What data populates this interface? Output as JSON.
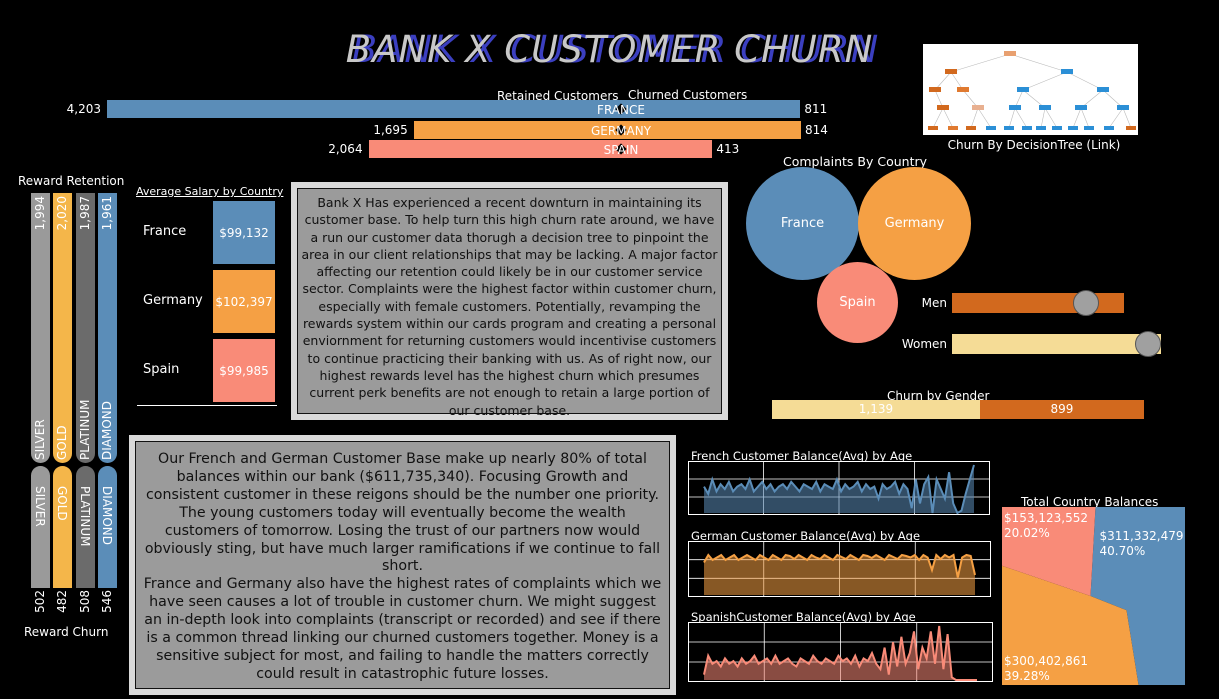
{
  "title": "BANK X CUSTOMER CHURN",
  "colors": {
    "france": "#5b8db8",
    "germany": "#f5a044",
    "spain": "#f98b78",
    "gray": "#9a9a9a",
    "gold": "#f4b64a",
    "dark_gray": "#6b6b6b",
    "men": "#d2691e",
    "women": "#f5dc96"
  },
  "country_churn": {
    "left_label": "Retained Customers",
    "right_label": "Churned Customers",
    "rows": [
      {
        "country": "FRANCE",
        "retained": 4203,
        "retained_label": "4,203",
        "churned": 811,
        "churned_label": "811"
      },
      {
        "country": "GERMANY",
        "retained": 1695,
        "retained_label": "1,695",
        "churned": 814,
        "churned_label": "814"
      },
      {
        "country": "SPAIN",
        "retained": 2064,
        "retained_label": "2,064",
        "churned": 413,
        "churned_label": "413"
      }
    ]
  },
  "tree": {
    "caption": "Churn By DecisionTree (Link)"
  },
  "rewards": {
    "top_title": "Reward Retention",
    "bottom_title": "Reward Churn",
    "tiers": [
      {
        "name": "SILVER",
        "retention": "1,994",
        "churn": "502"
      },
      {
        "name": "GOLD",
        "retention": "2,020",
        "churn": "482"
      },
      {
        "name": "PLATINUM",
        "retention": "1,987",
        "churn": "508"
      },
      {
        "name": "DIAMOND",
        "retention": "1,961",
        "churn": "546"
      }
    ]
  },
  "salary": {
    "title": "Average Salary by Country",
    "rows": [
      {
        "country": "France",
        "value": "$99,132"
      },
      {
        "country": "Germany",
        "value": "$102,397"
      },
      {
        "country": "Spain",
        "value": "$99,985"
      }
    ]
  },
  "text_top": "Bank X Has experienced a recent downturn in maintaining its customer base. To help turn this high churn rate around, we have a run our customer data thorugh a decision tree to pinpoint the area in our client relationships that may be lacking. A major factor affecting our retention could likely be in our customer service sector. Complaints were the highest factor within customer churn, especially with female customers. Potentially, revamping the rewards system within our cards program and creating a personal enviornment for returning customers would incentivise customers to continue practicing their banking with us. As of right now, our highest rewards level has the highest churn which presumes current perk benefits are not enough to retain a large portion of our customer base.",
  "text_bottom_1": "Our French and German Customer Base make up nearly 80% of total balances within our bank ($611,735,340). Focusing Growth and consistent customer in these reigons should be the number one priority. The young customers today will eventually become the wealth customers of tomorrow. Losing the trust of our partners now would obviously sting, but have much larger ramifications if we continue to fall short.",
  "text_bottom_2": "France and Germany also have the highest rates of complaints which we have seen causes a lot of trouble in customer churn. We might suggest an in-depth look into complaints (transcript or recorded) and see if there is a common thread linking our churned customers together. Money is a sensitive subject for most, and failing to handle the matters correctly could result in catastrophic future losses.",
  "complaints": {
    "title": "Complaints By Country",
    "labels": [
      "France",
      "Germany",
      "Spain"
    ]
  },
  "gender": {
    "rows": [
      {
        "label": "Men",
        "level": 0.78
      },
      {
        "label": "Women",
        "level": 0.95
      }
    ],
    "churn_title": "Churn by Gender",
    "churn_women": 1139,
    "churn_women_label": "1,139",
    "churn_men": 899,
    "churn_men_label": "899"
  },
  "balances": {
    "title": "Total Country Balances",
    "slices": [
      {
        "country": "France",
        "value": "$311,332,479",
        "pct": "40.70%",
        "share": 0.407
      },
      {
        "country": "Germany",
        "value": "$300,402,861",
        "pct": "39.28%",
        "share": 0.3928
      },
      {
        "country": "Spain",
        "value": "$153,123,552",
        "pct": "20.02%",
        "share": 0.2002
      }
    ]
  },
  "age_charts": [
    {
      "title": "French Customer Balance(Avg) by Age",
      "values": [
        0.55,
        0.4,
        0.7,
        0.45,
        0.6,
        0.5,
        0.65,
        0.45,
        0.55,
        0.6,
        0.5,
        0.7,
        0.45,
        0.55,
        0.65,
        0.5,
        0.6,
        0.45,
        0.55,
        0.6,
        0.5,
        0.65,
        0.55,
        0.45,
        0.6,
        0.55,
        0.5,
        0.65,
        0.45,
        0.6,
        0.55,
        0.5,
        0.7,
        0.45,
        0.6,
        0.5,
        0.55,
        0.65,
        0.45,
        0.6,
        0.5,
        0.55,
        0.3,
        0.6,
        0.5,
        0.55,
        0.65,
        0.4,
        0.6,
        0.5,
        0.1,
        0.7,
        0.2,
        0.6,
        0.75,
        0.0,
        0.7,
        0.5,
        0.3,
        0.85,
        0.2,
        0.0,
        0.05,
        0.4,
        0.7,
        1.0
      ]
    },
    {
      "title": "German Customer Balance(Avg) by Age",
      "values": [
        0.65,
        0.8,
        0.7,
        0.75,
        0.8,
        0.7,
        0.75,
        0.8,
        0.7,
        0.75,
        0.8,
        0.75,
        0.7,
        0.8,
        0.75,
        0.7,
        0.8,
        0.75,
        0.7,
        0.8,
        0.78,
        0.72,
        0.8,
        0.75,
        0.7,
        0.8,
        0.75,
        0.72,
        0.8,
        0.75,
        0.7,
        0.8,
        0.76,
        0.72,
        0.8,
        0.75,
        0.7,
        0.8,
        0.78,
        0.74,
        0.8,
        0.75,
        0.7,
        0.8,
        0.76,
        0.72,
        0.8,
        0.78,
        0.75,
        0.8,
        0.7,
        0.8,
        0.75,
        0.5,
        0.8,
        0.72,
        0.8,
        0.75,
        0.8,
        0.35,
        0.75,
        0.8,
        0.78,
        0.4
      ]
    },
    {
      "title": "SpanishCustomer Balance(Avg) by Age",
      "values": [
        0.1,
        0.45,
        0.3,
        0.35,
        0.25,
        0.4,
        0.3,
        0.35,
        0.25,
        0.4,
        0.3,
        0.35,
        0.45,
        0.3,
        0.35,
        0.4,
        0.3,
        0.45,
        0.3,
        0.35,
        0.4,
        0.3,
        0.25,
        0.4,
        0.35,
        0.3,
        0.45,
        0.35,
        0.3,
        0.4,
        0.35,
        0.3,
        0.45,
        0.35,
        0.4,
        0.3,
        0.45,
        0.25,
        0.4,
        0.35,
        0.5,
        0.3,
        0.2,
        0.6,
        0.1,
        0.7,
        0.25,
        0.8,
        0.3,
        0.5,
        0.9,
        0.2,
        0.6,
        0.4,
        0.9,
        0.3,
        1.0,
        0.2,
        0.85,
        0.05,
        0.0,
        0.0,
        0.0,
        0.0,
        0.0,
        0.0
      ]
    }
  ]
}
